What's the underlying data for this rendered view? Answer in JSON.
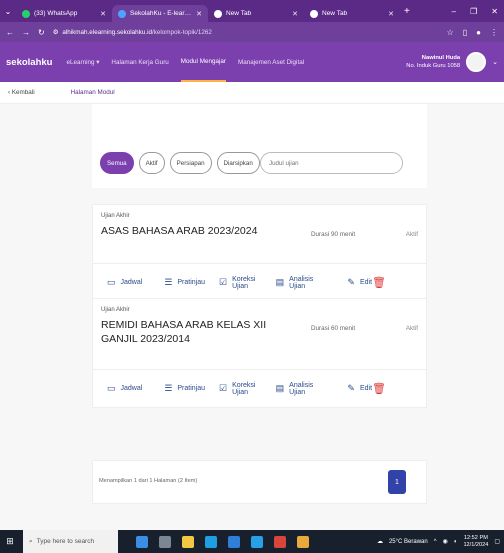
{
  "browser": {
    "tabs": [
      {
        "title": "(33) WhatsApp",
        "favicon_color": "#25d366",
        "active": false
      },
      {
        "title": "SekolahKu - E-learning",
        "favicon_color": "#4da3ff",
        "active": true
      },
      {
        "title": "New Tab",
        "favicon_color": "#ffffff",
        "active": false
      },
      {
        "title": "New Tab",
        "favicon_color": "#ffffff",
        "active": false
      }
    ],
    "url_host": "alhikmah.elearning.sekolahku.id",
    "url_path": "/kelompok-topik/1262"
  },
  "app": {
    "brand": "sekolahku",
    "menu": [
      {
        "label": "eLearning ▾",
        "active": false
      },
      {
        "label": "Halaman Kerja Guru",
        "active": false
      },
      {
        "label": "Modul Mengajar",
        "active": true
      },
      {
        "label": "Manajemen Aset Digital",
        "active": false
      }
    ],
    "user_name": "Nawinul Huda",
    "user_id": "No. Induk Guru 1058"
  },
  "breadcrumb": {
    "back": "Kembali",
    "current": "Halaman Modul"
  },
  "filters": {
    "pills": [
      "Semua",
      "Aktif",
      "Persiapan",
      "Diarsipkan"
    ],
    "active_index": 0,
    "search_placeholder": "Judul ujian"
  },
  "exams": [
    {
      "kind": "Ujian Akhir",
      "name": "ASAS BAHASA ARAB 2023/2024",
      "duration": "Durasi 90 menit",
      "status": "Aktif"
    },
    {
      "kind": "Ujian Akhir",
      "name": "REMIDI BAHASA ARAB KELAS XII GANJIL 2023/2014",
      "duration": "Durasi 60 menit",
      "status": "Aktif"
    }
  ],
  "actions": {
    "jadwal": "Jadwal",
    "pratinjau": "Pratinjau",
    "koreksi": "Koreksi Ujian",
    "analisis": "Analisis Ujian",
    "edit": "Edit"
  },
  "pagination": {
    "info": "Menampilkan 1 dari 1 Halaman (2 Item)",
    "page": "1"
  },
  "taskbar": {
    "search_placeholder": "Type here to search",
    "weather": "25°C Berawan",
    "time": "12:52 PM",
    "date": "12/1/2024"
  },
  "colors": {
    "brand_purple": "#7b3fae",
    "accent_orange": "#ffb347",
    "page_blue": "#3142a9",
    "danger": "#dd3333"
  }
}
